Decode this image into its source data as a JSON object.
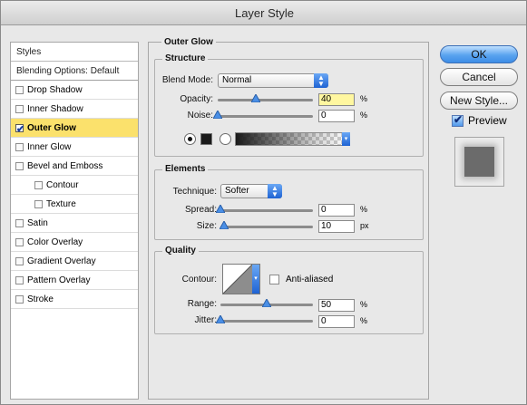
{
  "window": {
    "title": "Layer Style"
  },
  "styles_list": {
    "header": "Styles",
    "blending": "Blending Options: Default",
    "items": [
      {
        "label": "Drop Shadow",
        "checked": false,
        "selected": false,
        "indent": false
      },
      {
        "label": "Inner Shadow",
        "checked": false,
        "selected": false,
        "indent": false
      },
      {
        "label": "Outer Glow",
        "checked": true,
        "selected": true,
        "indent": false
      },
      {
        "label": "Inner Glow",
        "checked": false,
        "selected": false,
        "indent": false
      },
      {
        "label": "Bevel and Emboss",
        "checked": false,
        "selected": false,
        "indent": false
      },
      {
        "label": "Contour",
        "checked": false,
        "selected": false,
        "indent": true
      },
      {
        "label": "Texture",
        "checked": false,
        "selected": false,
        "indent": true
      },
      {
        "label": "Satin",
        "checked": false,
        "selected": false,
        "indent": false
      },
      {
        "label": "Color Overlay",
        "checked": false,
        "selected": false,
        "indent": false
      },
      {
        "label": "Gradient Overlay",
        "checked": false,
        "selected": false,
        "indent": false
      },
      {
        "label": "Pattern Overlay",
        "checked": false,
        "selected": false,
        "indent": false
      },
      {
        "label": "Stroke",
        "checked": false,
        "selected": false,
        "indent": false
      }
    ]
  },
  "outer_glow": {
    "title": "Outer Glow",
    "structure": {
      "title": "Structure",
      "blend_mode_label": "Blend Mode:",
      "blend_mode_value": "Normal",
      "opacity_label": "Opacity:",
      "opacity_value": "40",
      "opacity_unit": "%",
      "opacity_level": 0.4,
      "noise_label": "Noise:",
      "noise_value": "0",
      "noise_unit": "%",
      "noise_level": 0.0,
      "glow_color": "#1a1a1a"
    },
    "elements": {
      "title": "Elements",
      "technique_label": "Technique:",
      "technique_value": "Softer",
      "spread_label": "Spread:",
      "spread_value": "0",
      "spread_unit": "%",
      "spread_level": 0.0,
      "size_label": "Size:",
      "size_value": "10",
      "size_unit": "px",
      "size_level": 0.04
    },
    "quality": {
      "title": "Quality",
      "contour_label": "Contour:",
      "anti_aliased_label": "Anti-aliased",
      "anti_aliased_checked": false,
      "range_label": "Range:",
      "range_value": "50",
      "range_unit": "%",
      "range_level": 0.5,
      "jitter_label": "Jitter:",
      "jitter_value": "0",
      "jitter_unit": "%",
      "jitter_level": 0.0
    }
  },
  "buttons": {
    "ok": "OK",
    "cancel": "Cancel",
    "new_style": "New Style...",
    "preview_label": "Preview",
    "preview_checked": true
  },
  "colors": {
    "selection": "#fbe16c",
    "accent_blue": "#3d8de6"
  }
}
